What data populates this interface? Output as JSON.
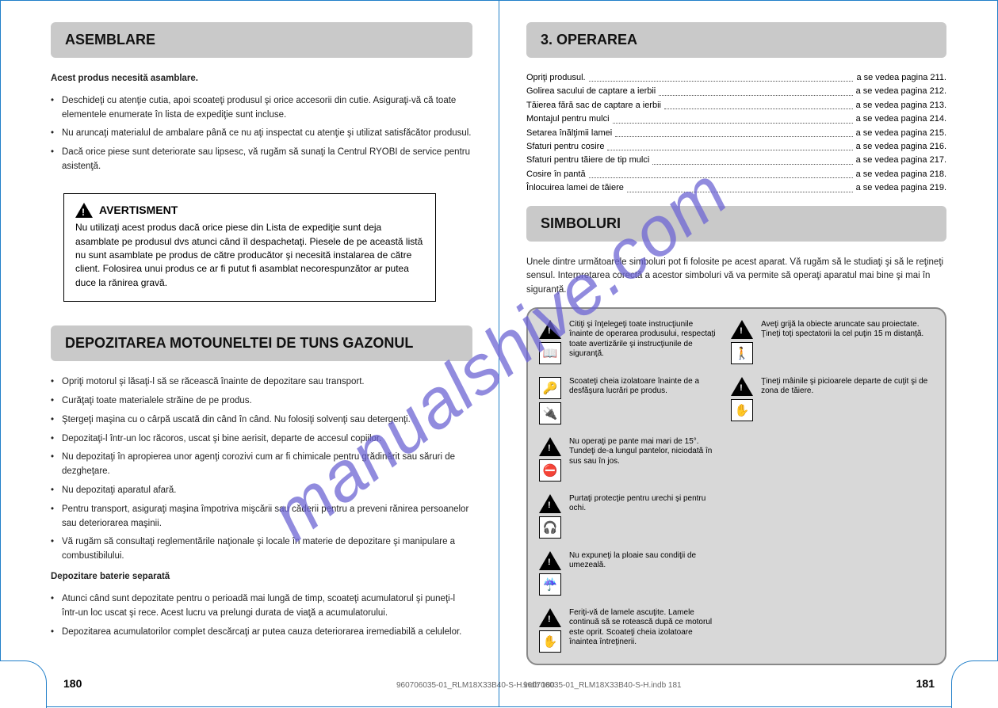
{
  "watermark": "manualshive.com",
  "left": {
    "h1": "ASEMBLARE",
    "p1_label": "Acest produs necesită asamblare.",
    "b1": "Deschideţi cu atenţie cutia, apoi scoateţi produsul şi orice accesorii din cutie. Asiguraţi-vă că toate elementele enumerate în lista de expediţie sunt incluse.",
    "b2": "Nu aruncaţi materialul de ambalare până ce nu aţi inspectat cu atenţie şi utilizat satisfăcător produsul.",
    "b3": "Dacă orice piese sunt deteriorate sau lipsesc, vă rugăm să sunaţi la Centrul RYOBI de service pentru asistenţă.",
    "warn_title": "AVERTISMENT",
    "warn_text": "Nu utilizaţi acest produs dacă orice piese din Lista de expediţie sunt deja asamblate pe produsul dvs atunci când îl despachetaţi. Piesele de pe această listă nu sunt asamblate pe produs de către producător şi necesită instalarea de către client. Folosirea unui produs ce ar fi putut fi asamblat necorespunzător ar putea duce la rănirea gravă.",
    "h2": "DEPOZITAREA MOTOUNELTEI DE TUNS GAZONUL",
    "bullets2": [
      "Opriţi motorul şi lăsaţi-l să se răcească înainte de depozitare sau transport.",
      "Curăţaţi toate materialele străine de pe produs.",
      "Ştergeţi maşina cu o cârpă uscată din când în când. Nu folosiţi solvenţi sau detergenţi.",
      "Depozitaţi-l într-un loc răcoros, uscat şi bine aerisit, departe de accesul copiilor.",
      "Nu depozitaţi în apropierea unor agenţi corozivi cum ar fi chimicale pentru grădinărit sau săruri de dezgheţare.",
      "Nu depozitaţi aparatul afară.",
      "Pentru transport, asiguraţi maşina împotriva mişcării sau căderii pentru a preveni rănirea persoanelor sau deteriorarea maşinii.",
      "Vă rugăm să consultaţi reglementările naţionale şi locale în materie de depozitare şi manipulare a combustibilului."
    ],
    "p_bat_h": "Depozitare baterie separată",
    "p_bat": [
      "Atunci când sunt depozitate pentru o perioadă mai lungă de timp, scoateţi acumulatorul şi puneţi-l într-un loc uscat şi rece. Acest lucru va prelungi durata de viaţă a acumulatorului.",
      "Depozitarea acumulatorilor complet descărcaţi ar putea cauza deteriorarea iremediabilă a celulelor."
    ]
  },
  "right": {
    "h1_num": "3.",
    "h1": "OPERAREA",
    "ops": [
      {
        "t": "Opriţi produsul.",
        "p": "a se vedea pagina 211."
      },
      {
        "t": "Golirea sacului de captare a ierbii",
        "p": "a se vedea pagina 212."
      },
      {
        "t": "Tăierea fără sac de captare a ierbii",
        "p": "a se vedea pagina 213."
      },
      {
        "t": "Montajul pentru mulci",
        "p": "a se vedea pagina 214."
      },
      {
        "t": "Setarea înălţimii lamei",
        "p": "a se vedea pagina 215."
      },
      {
        "t": "Sfaturi pentru cosire",
        "p": "a se vedea pagina 216."
      },
      {
        "t": "Sfaturi pentru tăiere de tip mulci",
        "p": "a se vedea pagina 217."
      },
      {
        "t": "Cosire în pantă",
        "p": "a se vedea pagina 218."
      },
      {
        "t": "Înlocuirea lamei de tăiere",
        "p": "a se vedea pagina 219."
      }
    ],
    "h2": "SIMBOLURI",
    "sym_intro": "Unele dintre următoarele simboluri pot fi folosite pe acest aparat. Vă rugăm să le studiaţi şi să le reţineţi sensul. Interpretarea corectă a acestor simboluri vă va permite să operaţi aparatul mai bine şi mai în siguranţă.",
    "symbols_left": [
      {
        "icons": [
          "tri",
          "book"
        ],
        "t": "Citiţi şi înţelegeţi toate instrucţiunile înainte de operarea produsului, respectaţi toate avertizările şi instrucţiunile de siguranţă."
      },
      {
        "icons": [
          "key",
          "plug"
        ],
        "t": "Scoateţi cheia izolatoare înainte de a desfăşura lucrări pe produs."
      },
      {
        "icons": [
          "tri",
          "nostep"
        ],
        "t": "Nu operaţi pe pante mai mari de 15°. Tundeţi de-a lungul pantelor, niciodată în sus sau în jos."
      },
      {
        "icons": [
          "tri",
          "ear"
        ],
        "t": "Purtaţi protecţie pentru urechi şi pentru ochi."
      },
      {
        "icons": [
          "tri",
          "rain"
        ],
        "t": "Nu expuneţi la ploaie sau condiţii de umezeală."
      },
      {
        "icons": [
          "tri",
          "blade"
        ],
        "t": "Feriţi-vă de lamele ascuţite. Lamele continuă să se rotească după ce motorul este oprit. Scoateţi cheia izolatoare înaintea întreţinerii."
      }
    ],
    "symbols_right": [
      {
        "icons": [
          "tri-shock",
          "person"
        ],
        "t": "Aveţi grijă la obiecte aruncate sau proiectate. Ţineţi toţi spectatorii la cel puţin 15 m distanţă."
      },
      {
        "icons": [
          "tri-shock",
          "hand"
        ],
        "t": "Ţineţi mâinile şi picioarele departe de cuţit şi de zona de tăiere."
      }
    ]
  },
  "footer": {
    "leftnum": "180",
    "rightnum": "181",
    "code_l": "960706035-01_RLM18X33B40-S-H.indb  180",
    "code_r": "960706035-01_RLM18X33B40-S-H.indb  181"
  }
}
